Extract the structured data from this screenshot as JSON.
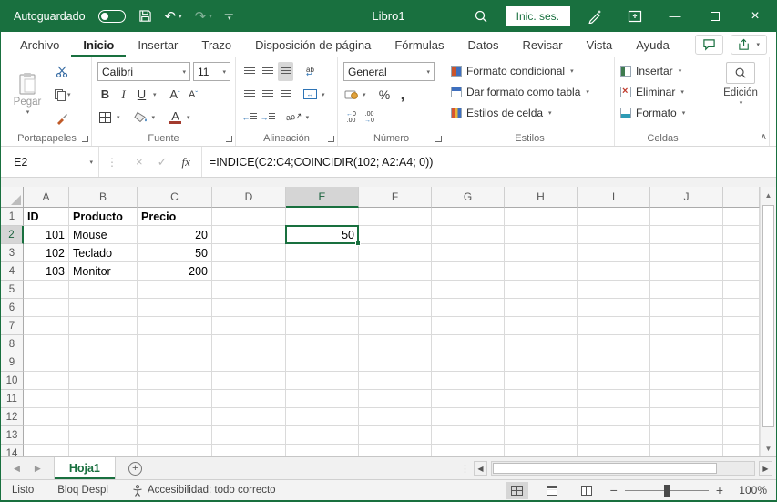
{
  "titlebar": {
    "autosave_label": "Autoguardado",
    "autosave_on": false,
    "title": "Libro1",
    "signin_label": "Inic. ses."
  },
  "ribbon_tabs": [
    "Archivo",
    "Inicio",
    "Insertar",
    "Trazo",
    "Disposición de página",
    "Fórmulas",
    "Datos",
    "Revisar",
    "Vista",
    "Ayuda"
  ],
  "active_tab": "Inicio",
  "ribbon": {
    "clipboard": {
      "label": "Portapapeles",
      "paste_label": "Pegar"
    },
    "font": {
      "label": "Fuente",
      "font_name": "Calibri",
      "font_size": "11"
    },
    "alignment": {
      "label": "Alineación"
    },
    "number": {
      "label": "Número",
      "format": "General"
    },
    "styles": {
      "label": "Estilos",
      "conditional": "Formato condicional",
      "format_table": "Dar formato como tabla",
      "cell_styles": "Estilos de celda"
    },
    "cells": {
      "label": "Celdas",
      "insert": "Insertar",
      "delete": "Eliminar",
      "format": "Formato"
    },
    "editing": {
      "label": "Edición"
    }
  },
  "formula_bar": {
    "name_box": "E2",
    "fx_label": "fx",
    "formula": "=INDICE(C2:C4;COINCIDIR(102; A2:A4; 0))"
  },
  "grid": {
    "columns": [
      "A",
      "B",
      "C",
      "D",
      "E",
      "F",
      "G",
      "H",
      "I",
      "J"
    ],
    "visible_rows": 14,
    "active_column": "E",
    "active_row": 2,
    "selection": {
      "ref": "E2"
    },
    "cells": [
      {
        "ref": "A1",
        "value": "ID",
        "bold": true,
        "align": "left"
      },
      {
        "ref": "B1",
        "value": "Producto",
        "bold": true,
        "align": "left"
      },
      {
        "ref": "C1",
        "value": "Precio",
        "bold": true,
        "align": "left"
      },
      {
        "ref": "A2",
        "value": "101",
        "align": "right"
      },
      {
        "ref": "B2",
        "value": "Mouse",
        "align": "left"
      },
      {
        "ref": "C2",
        "value": "20",
        "align": "right"
      },
      {
        "ref": "E2",
        "value": "50",
        "align": "right"
      },
      {
        "ref": "A3",
        "value": "102",
        "align": "right"
      },
      {
        "ref": "B3",
        "value": "Teclado",
        "align": "left"
      },
      {
        "ref": "C3",
        "value": "50",
        "align": "right"
      },
      {
        "ref": "A4",
        "value": "103",
        "align": "right"
      },
      {
        "ref": "B4",
        "value": "Monitor",
        "align": "left"
      },
      {
        "ref": "C4",
        "value": "200",
        "align": "right"
      }
    ]
  },
  "sheet_tabs": {
    "active": "Hoja1"
  },
  "status_bar": {
    "ready": "Listo",
    "scroll_lock": "Bloq Despl",
    "accessibility": "Accesibilidad: todo correcto",
    "zoom_level": "100%"
  },
  "colors": {
    "accent_green": "#19703F",
    "selection_border": "#19703F",
    "font_color_bar": "#A33B2E"
  },
  "icons": {
    "dropdown": "▾",
    "undo": "↶",
    "redo": "↷",
    "more-vertical": "⋮",
    "scroll-left": "◀",
    "scroll-right": "▶",
    "scroll-up": "▲",
    "scroll-down": "▼",
    "minimize": "—",
    "close": "×",
    "cancel": "×",
    "check": "✓",
    "percent": "%",
    "comma": ",",
    "merge": "↔",
    "wrap-return": "↩",
    "indent-left": "←",
    "indent-right": "→",
    "orientation": "ab↗",
    "wrap-ab": "ab",
    "bold": "B",
    "italic": "I",
    "underline": "U",
    "font-letter": "A",
    "caret-up": "ˆ",
    "caret-down": "ˇ",
    "collapse": "∧",
    "plus": "+",
    "minus": "−"
  }
}
